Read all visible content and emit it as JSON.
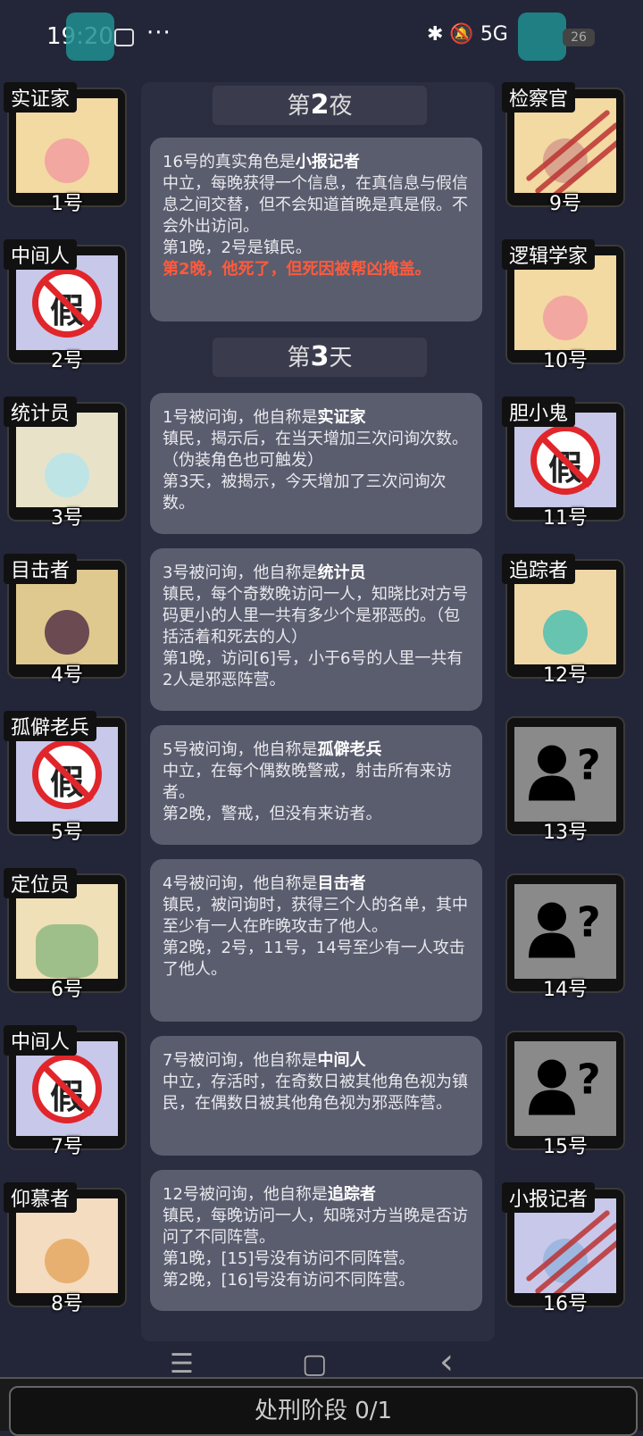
{
  "status_bar": {
    "time": "19:20",
    "dots": "···",
    "network": "✱ 🔕 5G",
    "battery": "26"
  },
  "left_cards": [
    {
      "role": "实证家",
      "number": "1号",
      "style": "figure"
    },
    {
      "role": "中间人",
      "number": "2号",
      "style": "fake"
    },
    {
      "role": "统计员",
      "number": "3号",
      "style": "art"
    },
    {
      "role": "目击者",
      "number": "4号",
      "style": "art"
    },
    {
      "role": "孤僻老兵",
      "number": "5号",
      "style": "fake"
    },
    {
      "role": "定位员",
      "number": "6号",
      "style": "art"
    },
    {
      "role": "中间人",
      "number": "7号",
      "style": "fake"
    },
    {
      "role": "仰慕者",
      "number": "8号",
      "style": "art"
    }
  ],
  "right_cards": [
    {
      "role": "检察官",
      "number": "9号",
      "style": "dead"
    },
    {
      "role": "逻辑学家",
      "number": "10号",
      "style": "figure"
    },
    {
      "role": "胆小鬼",
      "number": "11号",
      "style": "fake"
    },
    {
      "role": "追踪者",
      "number": "12号",
      "style": "art"
    },
    {
      "role": "",
      "number": "13号",
      "style": "unknown"
    },
    {
      "role": "",
      "number": "14号",
      "style": "unknown"
    },
    {
      "role": "",
      "number": "15号",
      "style": "unknown"
    },
    {
      "role": "小报记者",
      "number": "16号",
      "style": "dead"
    }
  ],
  "log": {
    "night2": {
      "prefix": "第",
      "num": "2",
      "suffix": "夜"
    },
    "day3": {
      "prefix": "第",
      "num": "3",
      "suffix": "天"
    },
    "m1": {
      "l1a": "16号的真实角色是",
      "l1b": "小报记者",
      "l2": "中立，每晚获得一个信息，在真信息与假信息之间交替，但不会知道首晚是真是假。不会外出访问。",
      "l3": "第1晚，2号是镇民。",
      "l4": "第2晚，他死了，但死因被帮凶掩盖。"
    },
    "m2": {
      "l1a": "1号被问询，他自称是",
      "l1b": "实证家",
      "l2": "镇民，揭示后，在当天增加三次问询次数。（伪装角色也可触发）",
      "l3": "第3天，被揭示，今天增加了三次问询次数。"
    },
    "m3": {
      "l1a": "3号被问询，他自称是",
      "l1b": "统计员",
      "l2": "镇民，每个奇数晚访问一人，知晓比对方号码更小的人里一共有多少个是邪恶的。（包括活着和死去的人）",
      "l3": "第1晚，访问[6]号，小于6号的人里一共有2人是邪恶阵营。"
    },
    "m4": {
      "l1a": "5号被问询，他自称是",
      "l1b": "孤僻老兵",
      "l2": "中立，在每个偶数晚警戒，射击所有来访者。",
      "l3": "第2晚，警戒，但没有来访者。"
    },
    "m5": {
      "l1a": "4号被问询，他自称是",
      "l1b": "目击者",
      "l2": "镇民，被问询时，获得三个人的名单，其中至少有一人在昨晚攻击了他人。",
      "l3": "第2晚，2号，11号，14号至少有一人攻击了他人。"
    },
    "m6": {
      "l1a": "7号被问询，他自称是",
      "l1b": "中间人",
      "l2": "中立，存活时，在奇数日被其他角色视为镇民，在偶数日被其他角色视为邪恶阵营。"
    },
    "m7": {
      "l1a": "12号被问询，他自称是",
      "l1b": "追踪者",
      "l2": "镇民，每晚访问一人，知晓对方当晚是否访问了不同阵营。",
      "l3": "第1晚，[15]号没有访问不同阵营。",
      "l4": "第2晚，[16]号没有访问不同阵营。"
    }
  },
  "fake_char": "假",
  "nav": {
    "menu": "☰",
    "home": "▢",
    "back": "‹"
  },
  "footer": {
    "phase": "处刑阶段 0/1"
  }
}
